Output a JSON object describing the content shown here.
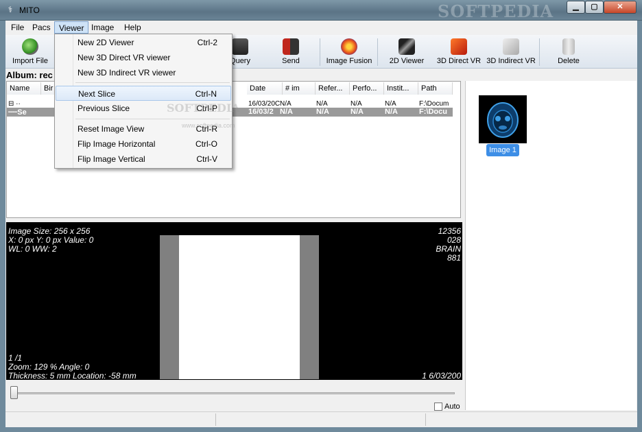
{
  "window": {
    "title": "MITO",
    "app_icon": "caduceus-icon",
    "watermark": "SOFTPEDIA",
    "min": "▁",
    "max": "▢",
    "close": "✕"
  },
  "menubar": {
    "file": "File",
    "pacs": "Pacs",
    "viewer": "Viewer",
    "image": "Image",
    "help": "Help"
  },
  "toolbar": {
    "import": "Import File",
    "query": "Query",
    "send": "Send",
    "fusion": "Image Fusion",
    "viewer2d": "2D Viewer",
    "direct3d": "3D Direct VR",
    "indirect3d": "3D Indirect VR",
    "delete": "Delete"
  },
  "album": {
    "label": "Album: rec"
  },
  "list": {
    "columns": {
      "name": "Name",
      "birth": "Bir",
      "date": "Date",
      "num": "# im",
      "ref": "Refer...",
      "perf": "Perfo...",
      "inst": "Instit...",
      "path": "Path"
    },
    "row1": {
      "tree": "⊟ ··",
      "date": "16/03/20C",
      "num": "N/A",
      "ref": "N/A",
      "perf": "N/A",
      "inst": "N/A",
      "path": "F:\\Docum"
    },
    "row2": {
      "tree": "┈┈Se",
      "date": "16/03/2",
      "num": "N/A",
      "ref": "N/A",
      "perf": "N/A",
      "inst": "N/A",
      "path": "F:\\Docu"
    }
  },
  "thumb": {
    "label": "Image 1"
  },
  "viewer": {
    "size": "Image Size: 256 x 256",
    "pos": "X: 0 px Y: 0 px Value: 0",
    "wl": "WL: 0 WW: 2",
    "r1": "12356",
    "r2": "028",
    "r3": "BRAIN",
    "r4": "881",
    "frame": "1 /1",
    "zoom": "Zoom: 129 % Angle: 0",
    "thick": "Thickness: 5 mm Location: -58 mm",
    "date": "1 6/03/200"
  },
  "slider": {
    "auto": "Auto"
  },
  "dropdown": {
    "new2d": {
      "label": "New 2D Viewer",
      "key": "Ctrl-2"
    },
    "new3dd": {
      "label": "New 3D Direct VR viewer",
      "key": ""
    },
    "new3di": {
      "label": "New 3D Indirect VR viewer",
      "key": ""
    },
    "next": {
      "label": "Next Slice",
      "key": "Ctrl-N"
    },
    "prev": {
      "label": "Previous Slice",
      "key": "Ctrl-P"
    },
    "reset": {
      "label": "Reset Image View",
      "key": "Ctrl-R"
    },
    "fliph": {
      "label": "Flip Image Horizontal",
      "key": "Ctrl-O"
    },
    "flipv": {
      "label": "Flip Image Vertical",
      "key": "Ctrl-V"
    }
  },
  "watermark_mid": "SOFTPEDIA",
  "watermark_url": "www.softpedia.com"
}
